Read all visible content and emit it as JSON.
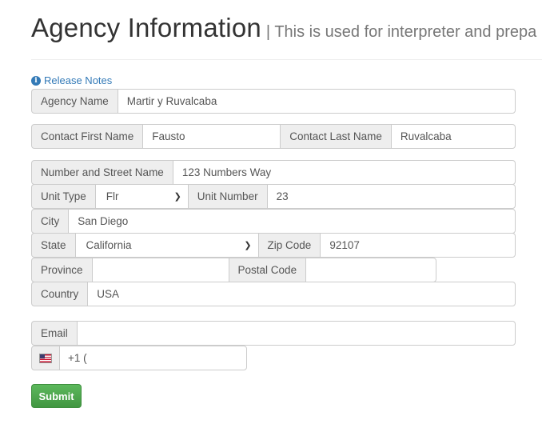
{
  "header": {
    "title": "Agency Information",
    "subtitle": "| This is used for interpreter and prepa"
  },
  "release_notes": {
    "label": "Release Notes",
    "icon": "info-circle-icon"
  },
  "form": {
    "agency_name": {
      "label": "Agency Name",
      "value": "Martir y Ruvalcaba"
    },
    "contact_first_name": {
      "label": "Contact First Name",
      "value": "Fausto"
    },
    "contact_last_name": {
      "label": "Contact Last Name",
      "value": "Ruvalcaba"
    },
    "street": {
      "label": "Number and Street Name",
      "value": "123 Numbers Way"
    },
    "unit_type": {
      "label": "Unit Type",
      "value": "Flr"
    },
    "unit_number": {
      "label": "Unit Number",
      "value": "23"
    },
    "city": {
      "label": "City",
      "value": "San Diego"
    },
    "state": {
      "label": "State",
      "value": "California"
    },
    "zip": {
      "label": "Zip Code",
      "value": "92107"
    },
    "province": {
      "label": "Province",
      "value": ""
    },
    "postal_code": {
      "label": "Postal Code",
      "value": ""
    },
    "country": {
      "label": "Country",
      "value": "USA"
    },
    "email": {
      "label": "Email",
      "value": ""
    },
    "phone": {
      "flag": "us-flag-icon",
      "value": "+1 ("
    }
  },
  "submit_label": "Submit",
  "colors": {
    "link": "#337ab7",
    "addon_bg": "#eeeeee",
    "border": "#cccccc",
    "submit": "#5cb85c"
  }
}
